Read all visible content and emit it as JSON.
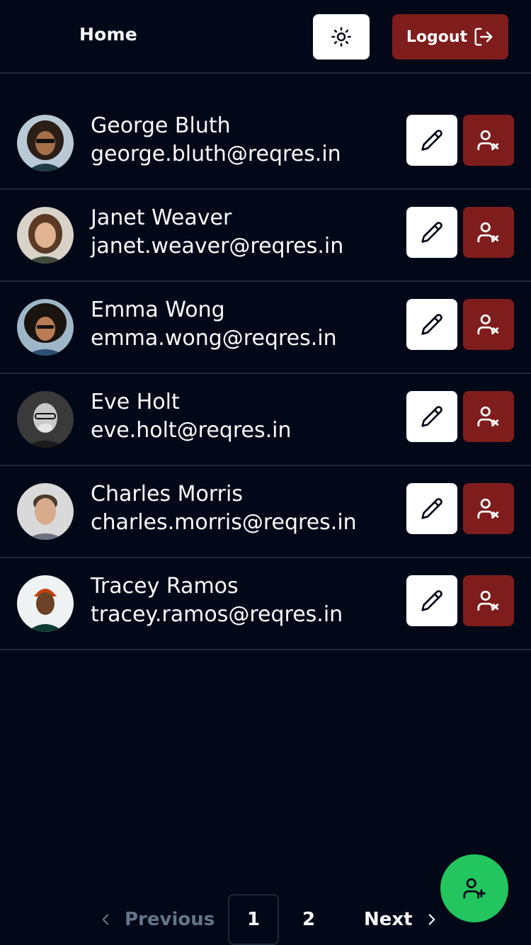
{
  "header": {
    "home_label": "Home",
    "theme_icon": "sun-icon",
    "logout_label": "Logout",
    "logout_icon": "logout-icon"
  },
  "users": [
    {
      "name": "George Bluth",
      "email": "george.bluth@reqres.in"
    },
    {
      "name": "Janet Weaver",
      "email": "janet.weaver@reqres.in"
    },
    {
      "name": "Emma Wong",
      "email": "emma.wong@reqres.in"
    },
    {
      "name": "Eve Holt",
      "email": "eve.holt@reqres.in"
    },
    {
      "name": "Charles Morris",
      "email": "charles.morris@reqres.in"
    },
    {
      "name": "Tracey Ramos",
      "email": "tracey.ramos@reqres.in"
    }
  ],
  "pagination": {
    "previous_label": "Previous",
    "pages": [
      "1",
      "2"
    ],
    "current_page": "1",
    "next_label": "Next"
  },
  "colors": {
    "background": "#020817",
    "danger": "#7f1d1d",
    "success": "#22c55e",
    "border": "#1e293b"
  },
  "icons": {
    "edit": "pencil-icon",
    "delete": "user-x-icon",
    "add": "user-plus-icon"
  }
}
